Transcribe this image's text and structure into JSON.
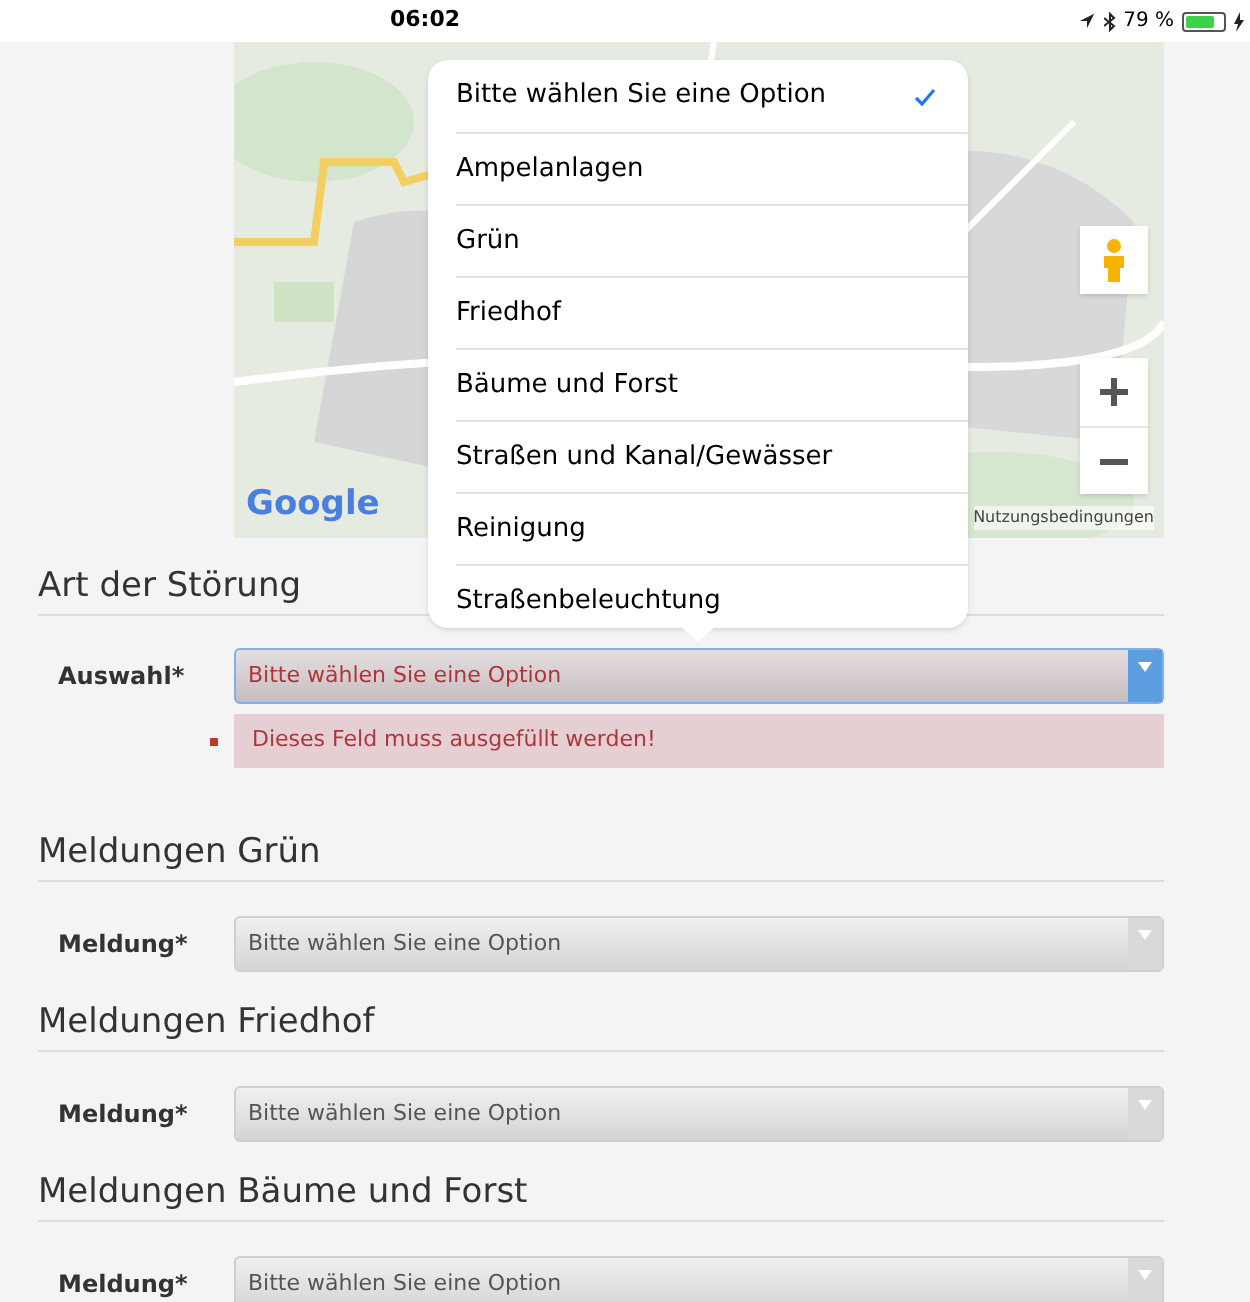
{
  "status_bar": {
    "time": "06:02",
    "battery": "79 %"
  },
  "map": {
    "kind": "picture",
    "logo": "Google",
    "terms": "Nutzungsbedingungen"
  },
  "picker": {
    "options": [
      {
        "label": "Bitte wählen Sie eine Option",
        "selected": true
      },
      {
        "label": "Ampelanlagen",
        "selected": false
      },
      {
        "label": "Grün",
        "selected": false
      },
      {
        "label": "Friedhof",
        "selected": false
      },
      {
        "label": "Bäume und Forst",
        "selected": false
      },
      {
        "label": "Straßen und Kanal/Gewässer",
        "selected": false
      },
      {
        "label": "Reinigung",
        "selected": false
      },
      {
        "label": "Straßenbeleuchtung",
        "selected": false
      }
    ]
  },
  "sections": [
    {
      "title": "Art der Störung",
      "label": "Auswahl*",
      "value": "Bitte wählen Sie eine Option",
      "invalid": true,
      "error": "Dieses Feld muss ausgefüllt werden!"
    },
    {
      "title": "Meldungen Grün",
      "label": "Meldung*",
      "value": "Bitte wählen Sie eine Option",
      "invalid": false
    },
    {
      "title": "Meldungen Friedhof",
      "label": "Meldung*",
      "value": "Bitte wählen Sie eine Option",
      "invalid": false
    },
    {
      "title": "Meldungen Bäume und Forst",
      "label": "Meldung*",
      "value": "Bitte wählen Sie eine Option",
      "invalid": false
    }
  ]
}
